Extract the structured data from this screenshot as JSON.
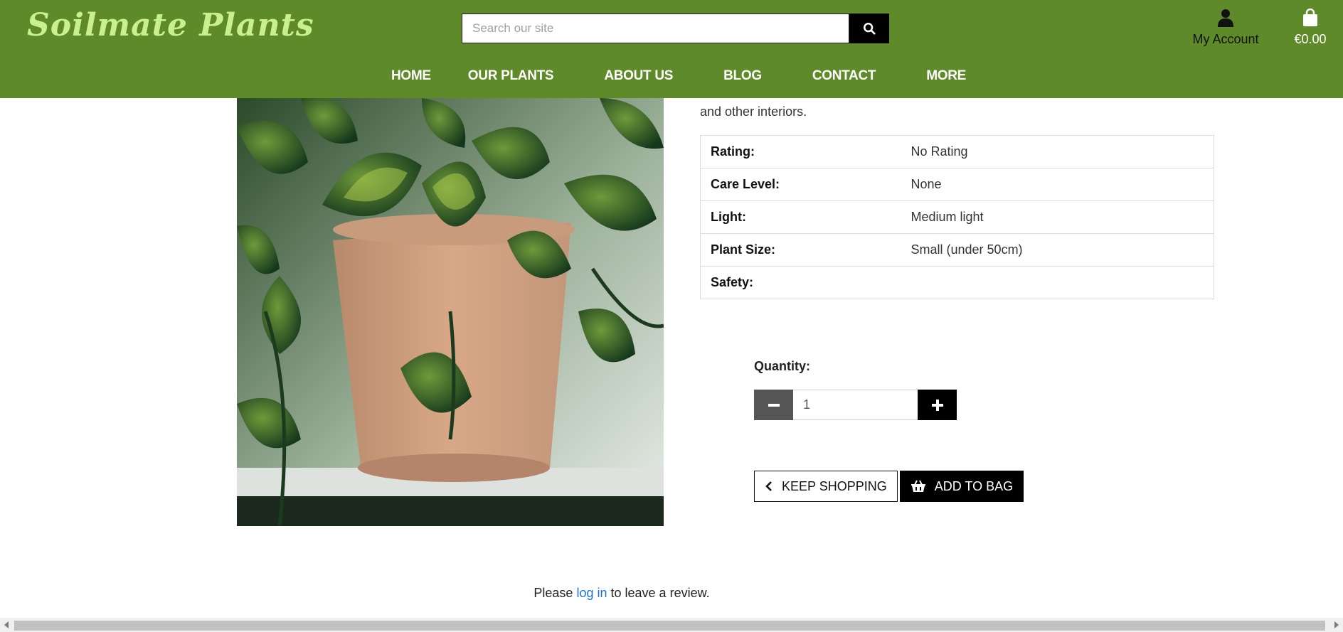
{
  "header": {
    "logo": "Soilmate Plants",
    "search_placeholder": "Search our site",
    "account_label": "My Account",
    "bag_total": "€0.00"
  },
  "nav": {
    "items": [
      {
        "label": "HOME"
      },
      {
        "label": "OUR PLANTS"
      },
      {
        "label": "ABOUT US"
      },
      {
        "label": "BLOG"
      },
      {
        "label": "CONTACT"
      },
      {
        "label": "MORE"
      }
    ]
  },
  "product": {
    "description_tail": "and other interiors.",
    "details": [
      {
        "key": "Rating:",
        "value": "No Rating"
      },
      {
        "key": "Care Level:",
        "value": "None"
      },
      {
        "key": "Light:",
        "value": "Medium light"
      },
      {
        "key": "Plant Size:",
        "value": "Small (under 50cm)"
      },
      {
        "key": "Safety:",
        "value": ""
      }
    ],
    "quantity_label": "Quantity:",
    "quantity_value": "1"
  },
  "actions": {
    "keep_shopping": "KEEP SHOPPING",
    "add_to_bag": "ADD TO BAG"
  },
  "review": {
    "prefix": "Please",
    "link": "log in",
    "suffix": "to leave a review."
  },
  "colors": {
    "header_bg": "#5f8a29",
    "logo": "#c9ef8e",
    "link": "#1a73d9"
  }
}
